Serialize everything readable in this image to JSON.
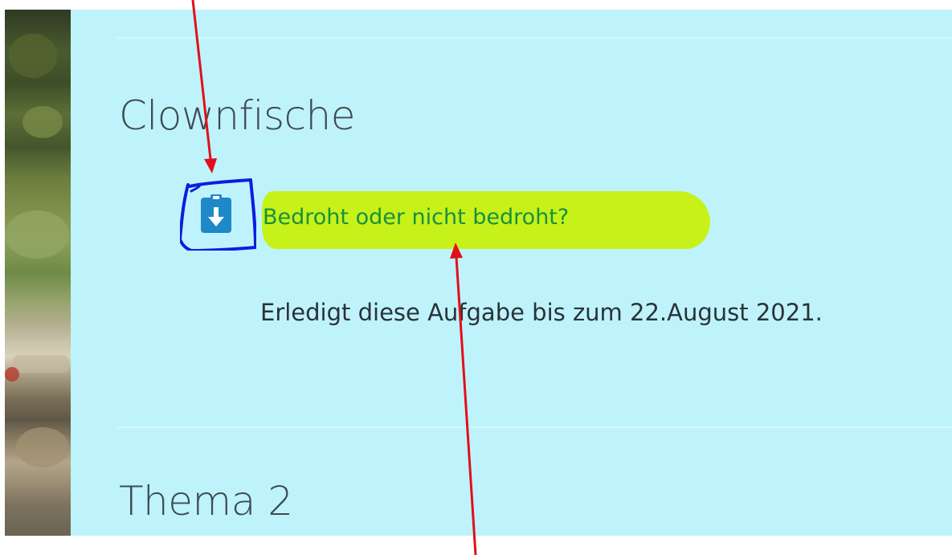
{
  "course": {
    "sections": [
      {
        "title": "Clownfische",
        "activity": {
          "icon": "assignment-download-icon",
          "link_label": "Bedroht oder nicht bedroht?",
          "description": "Erledigt diese Aufgabe bis zum 22.August 2021."
        }
      },
      {
        "title": "Thema 2"
      }
    ]
  },
  "colors": {
    "content_background": "#bff3fb",
    "link_color": "#1a8f3e",
    "highlight_marker": "#c6f21a",
    "icon_outline": "#0a1fe0",
    "icon_fill": "#1e88c8",
    "annotation_arrow": "#e0101a"
  }
}
